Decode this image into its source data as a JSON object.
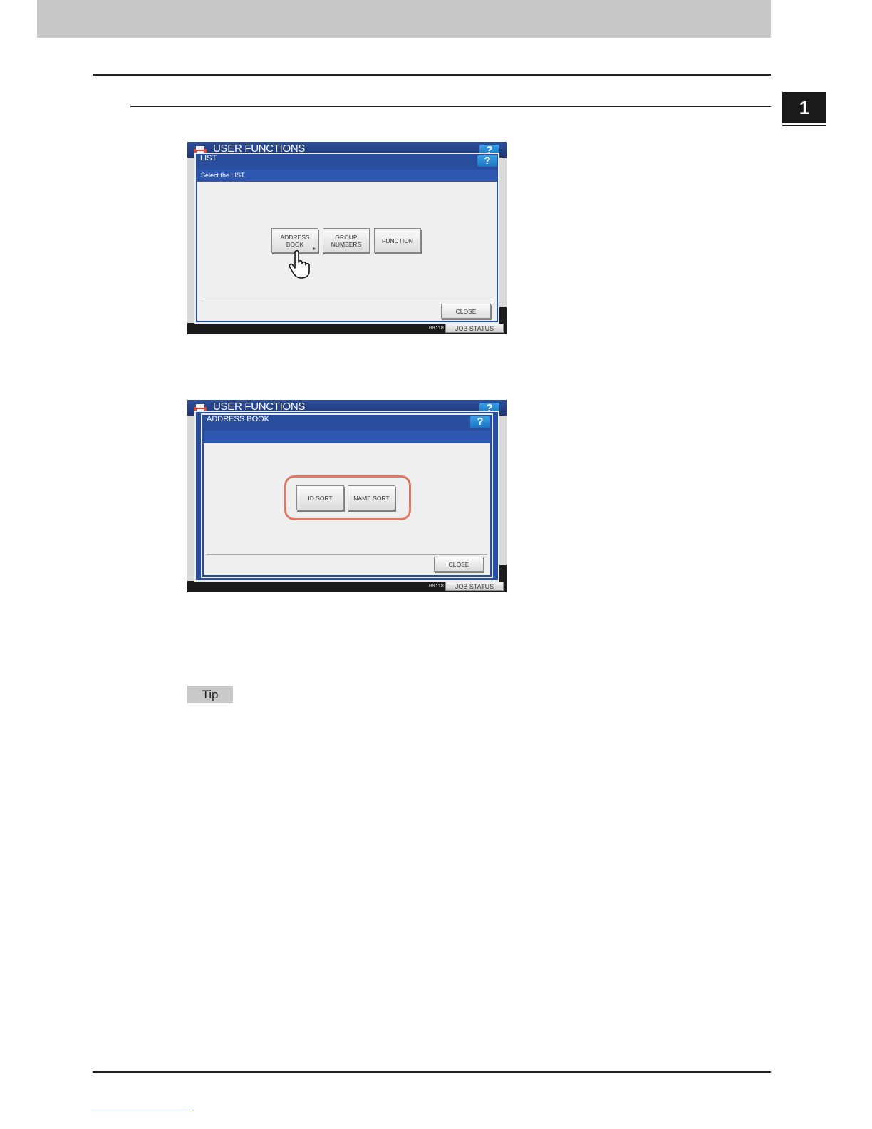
{
  "chapter": {
    "number": "1"
  },
  "screen1": {
    "app_title": "USER FUNCTIONS",
    "help_label": "?",
    "dialog_title": "LIST",
    "dialog_help_label": "?",
    "instruction": "Select the LIST.",
    "buttons": [
      {
        "label_line1": "ADDRESS",
        "label_line2": "BOOK"
      },
      {
        "label_line1": "GROUP",
        "label_line2": "NUMBERS"
      },
      {
        "label": "FUNCTION"
      }
    ],
    "close_label": "CLOSE",
    "clock_time": "08:18",
    "job_status_label": "JOB STATUS"
  },
  "screen2": {
    "app_title": "USER FUNCTIONS",
    "help_label": "?",
    "dialog_title": "ADDRESS BOOK",
    "dialog_help_label": "?",
    "buttons": [
      {
        "label": "ID SORT"
      },
      {
        "label": "NAME SORT"
      }
    ],
    "close_label": "CLOSE",
    "clock_time": "08:18",
    "job_status_label": "JOB STATUS"
  },
  "tip": {
    "label": "Tip"
  },
  "colors": {
    "highlight": "#e07866",
    "title_bar": "#1d3677",
    "help_button": "#1a74c2"
  }
}
